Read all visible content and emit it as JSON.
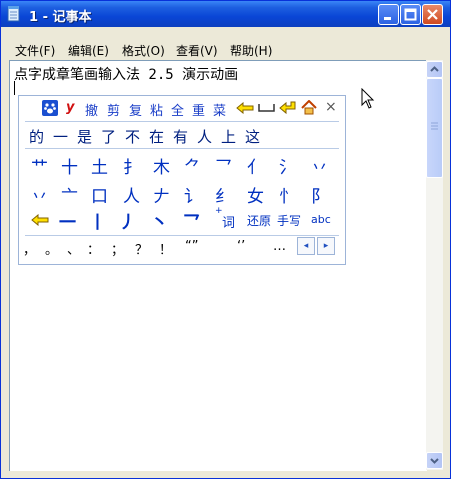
{
  "window": {
    "title": "1 - 记事本",
    "colors": {
      "titlebar": "#0a46d6",
      "frame": "#0831d9"
    }
  },
  "menu": [
    "文件(F)",
    "编辑(E)",
    "格式(O)",
    "查看(V)",
    "帮助(H)"
  ],
  "editor": {
    "text": "点字成章笔画输入法 2.5 演示动画"
  },
  "ime": {
    "toolbar": {
      "logo": "paw-icon",
      "y_label": "y",
      "undo": "撤",
      "cut": "剪",
      "copy": "复",
      "paste": "粘",
      "all": "全",
      "redo": "重",
      "vegetable": "菜",
      "close": "×"
    },
    "candidates": [
      "的",
      "一",
      "是",
      "了",
      "不",
      "在",
      "有",
      "人",
      "上",
      "这"
    ],
    "strokes_row1": [
      "艹",
      "十",
      "土",
      "扌",
      "木",
      "⺈",
      "乛",
      "亻",
      "氵",
      "丷"
    ],
    "strokes_row2": [
      "丷",
      "亠",
      "口",
      "人",
      "𠂇",
      "讠",
      "纟",
      "女",
      "忄",
      "阝"
    ],
    "strokes_row3": [
      "一",
      "丨",
      "丿",
      "丶",
      "乛"
    ],
    "word_label": "词",
    "restore_label": "还原",
    "handwrite_label": "手写",
    "abc_label": "abc",
    "punctuation": [
      "，",
      "。",
      "、",
      "：",
      "；",
      "？",
      "！",
      "“”",
      "‘’",
      "…"
    ],
    "nav_prev": "◂",
    "nav_next": "▸"
  }
}
